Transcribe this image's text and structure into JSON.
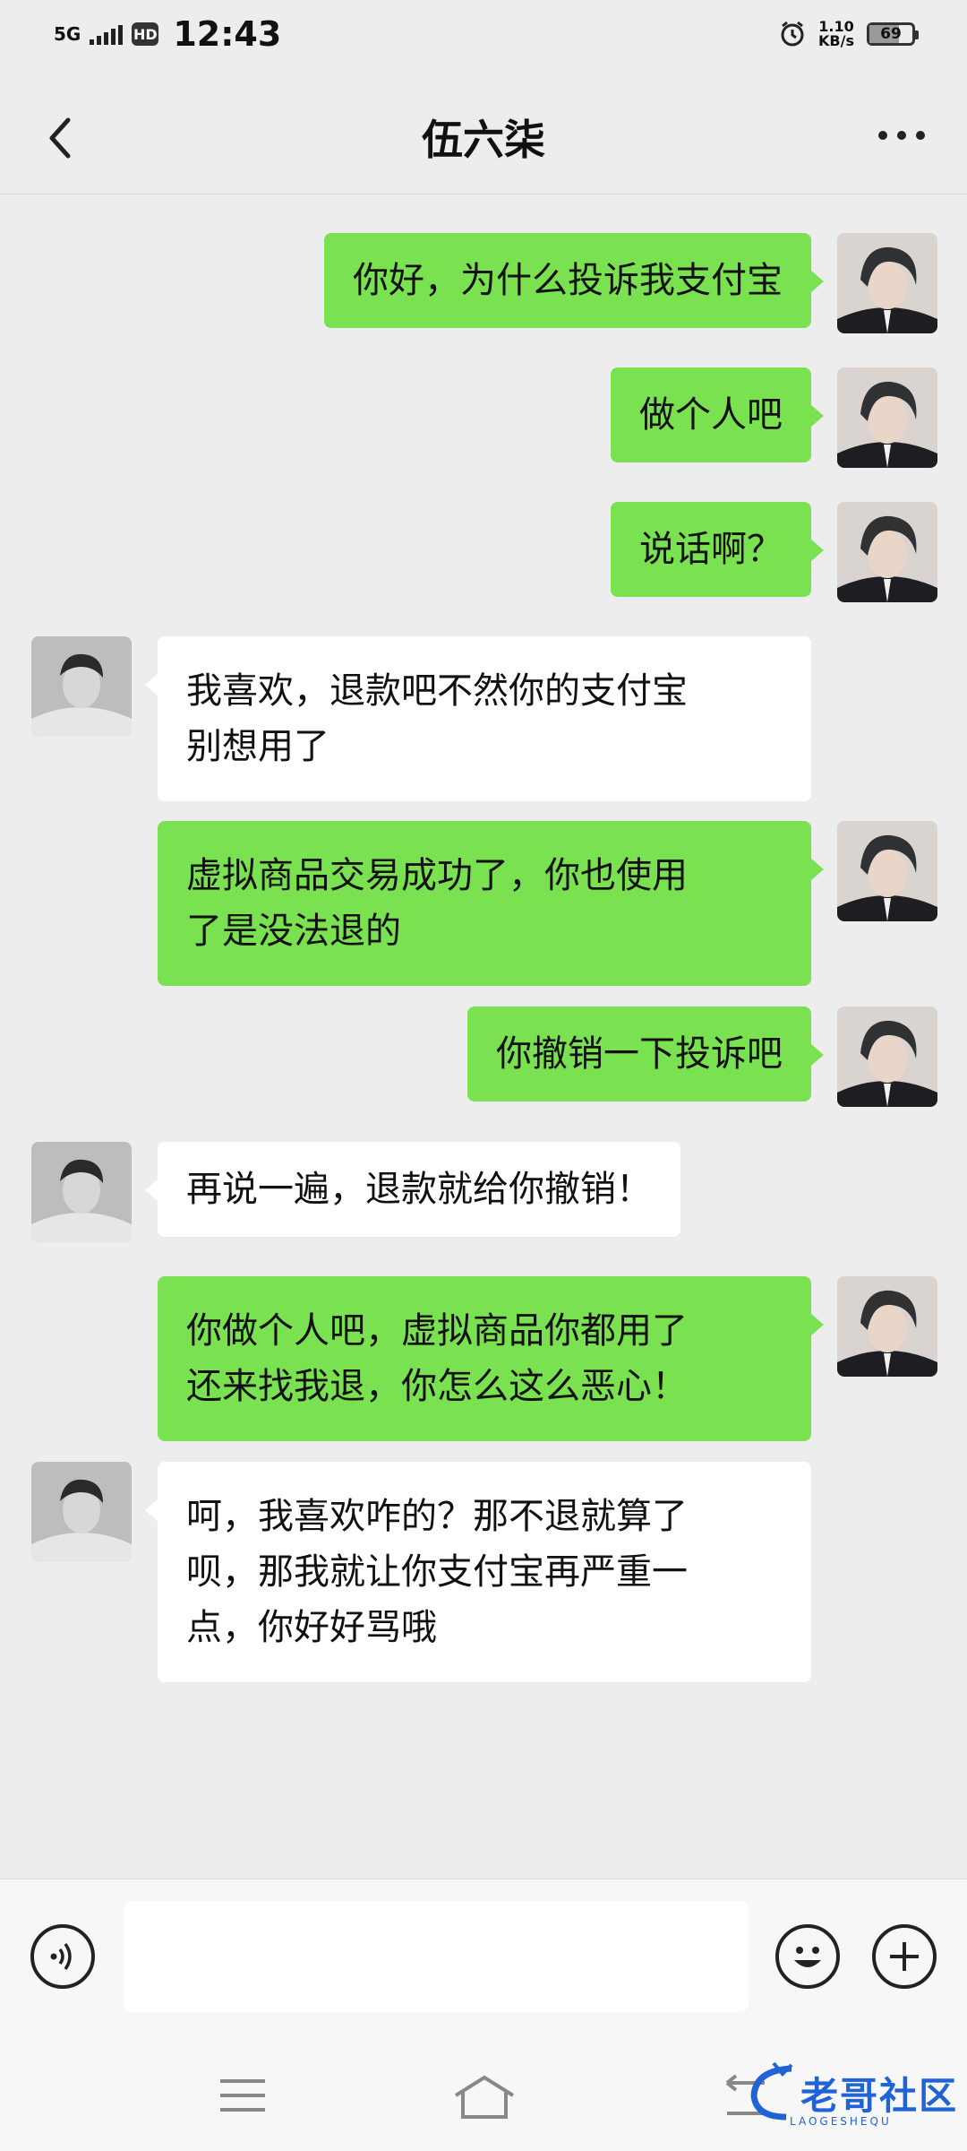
{
  "status_bar": {
    "network": "5G",
    "hd_badge": "HD",
    "time": "12:43",
    "speed_value": "1.10",
    "speed_unit": "KB/s",
    "battery": "69",
    "battery_level": 0.69
  },
  "header": {
    "title": "伍六柒"
  },
  "messages": [
    {
      "side": "out",
      "text": "你好，为什么投诉我支付宝"
    },
    {
      "side": "out",
      "text": "做个人吧"
    },
    {
      "side": "out",
      "text": "说话啊？"
    },
    {
      "side": "in",
      "text": "我喜欢，退款吧不然你的支付宝\n别想用了"
    },
    {
      "side": "out",
      "text": "虚拟商品交易成功了，你也使用\n了是没法退的"
    },
    {
      "side": "out",
      "text": "你撤销一下投诉吧"
    },
    {
      "side": "in",
      "text": "再说一遍，退款就给你撤销！"
    },
    {
      "side": "out",
      "text": "你做个人吧，虚拟商品你都用了\n还来找我退，你怎么这么恶心！"
    },
    {
      "side": "in",
      "text": "呵，我喜欢咋的？那不退就算了\n呗，那我就让你支付宝再严重一\n点，你好好骂哦"
    }
  ],
  "input_bar": {
    "voice_icon": "voice-icon",
    "emoji_icon": "emoji-icon",
    "plus_icon": "plus-icon",
    "placeholder": ""
  },
  "watermark": {
    "text": "老哥社区",
    "sub": "LAOGESHEQU"
  },
  "colors": {
    "outgoing_bubble": "#7ae150",
    "incoming_bubble": "#ffffff",
    "background": "#ededed"
  }
}
